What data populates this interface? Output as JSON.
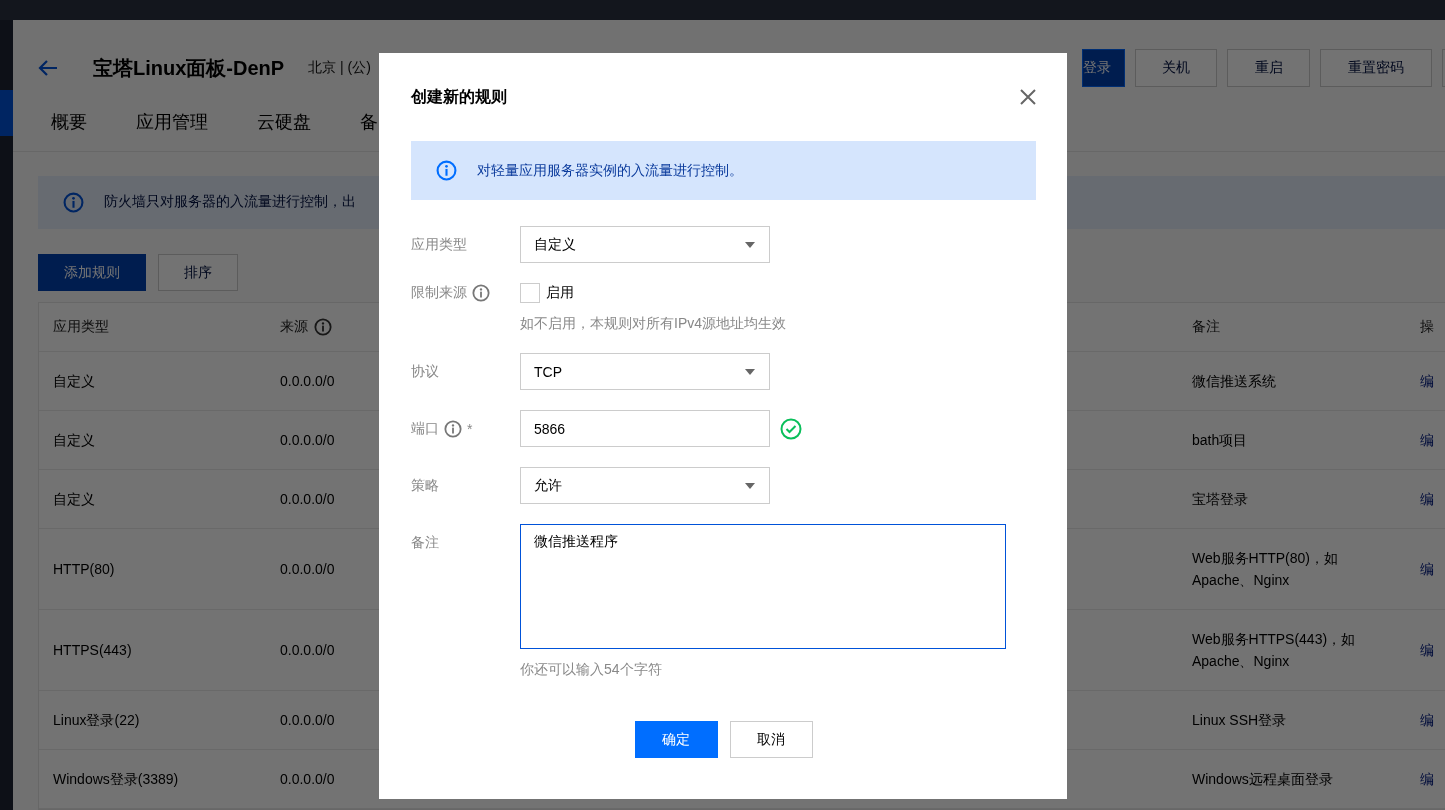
{
  "header": {
    "title": "宝塔Linux面板-DenP",
    "region": "北京 | (公)",
    "buttons": [
      {
        "label": "登录",
        "primary": true
      },
      {
        "label": "关机",
        "primary": false
      },
      {
        "label": "重启",
        "primary": false
      },
      {
        "label": "重置密码",
        "primary": false
      }
    ]
  },
  "tabs": [
    {
      "label": "概要",
      "selected": false
    },
    {
      "label": "应用管理",
      "selected": false
    },
    {
      "label": "云硬盘",
      "selected": false
    },
    {
      "label": "备",
      "selected": false
    }
  ],
  "notice": "防火墙只对服务器的入流量进行控制，出",
  "toolbar": [
    {
      "label": "添加规则",
      "primary": true
    },
    {
      "label": "排序",
      "primary": false
    }
  ],
  "table": {
    "columns": [
      {
        "label": "应用类型",
        "info": false
      },
      {
        "label": "来源",
        "info": true
      },
      {
        "label": "备注",
        "info": false
      },
      {
        "label": "操",
        "info": false
      }
    ],
    "rows": [
      {
        "type": "自定义",
        "source": "0.0.0.0/0",
        "note": "微信推送系统",
        "action": "编"
      },
      {
        "type": "自定义",
        "source": "0.0.0.0/0",
        "note": "bath项目",
        "action": "编"
      },
      {
        "type": "自定义",
        "source": "0.0.0.0/0",
        "note": "宝塔登录",
        "action": "编"
      },
      {
        "type": "HTTP(80)",
        "source": "0.0.0.0/0",
        "note": "Web服务HTTP(80)，如Apache、Nginx",
        "action": "编"
      },
      {
        "type": "HTTPS(443)",
        "source": "0.0.0.0/0",
        "note": "Web服务HTTPS(443)，如Apache、Nginx",
        "action": "编"
      },
      {
        "type": "Linux登录(22)",
        "source": "0.0.0.0/0",
        "note": "Linux SSH登录",
        "action": "编"
      },
      {
        "type": "Windows登录(3389)",
        "source": "0.0.0.0/0",
        "note": "Windows远程桌面登录",
        "action": "编"
      }
    ]
  },
  "dialog": {
    "title": "创建新的规则",
    "notice": "对轻量应用服务器实例的入流量进行控制。",
    "fields": [
      {
        "kind": "select",
        "label": "应用类型",
        "value": "自定义"
      },
      {
        "kind": "checkbox",
        "label": "限制来源",
        "info": true,
        "checked": false,
        "option": "启用",
        "hint": "如不启用，本规则对所有IPv4源地址均生效"
      },
      {
        "kind": "select",
        "label": "协议",
        "value": "TCP"
      },
      {
        "kind": "input",
        "label": "端口",
        "info": true,
        "required_mark": "*",
        "value": "5866",
        "valid": true
      },
      {
        "kind": "select",
        "label": "策略",
        "value": "允许"
      },
      {
        "kind": "textarea",
        "label": "备注",
        "value": "微信推送程序",
        "hint": "你还可以输入54个字符"
      }
    ],
    "buttons": [
      {
        "label": "确定",
        "primary": true
      },
      {
        "label": "取消",
        "primary": false
      }
    ]
  }
}
